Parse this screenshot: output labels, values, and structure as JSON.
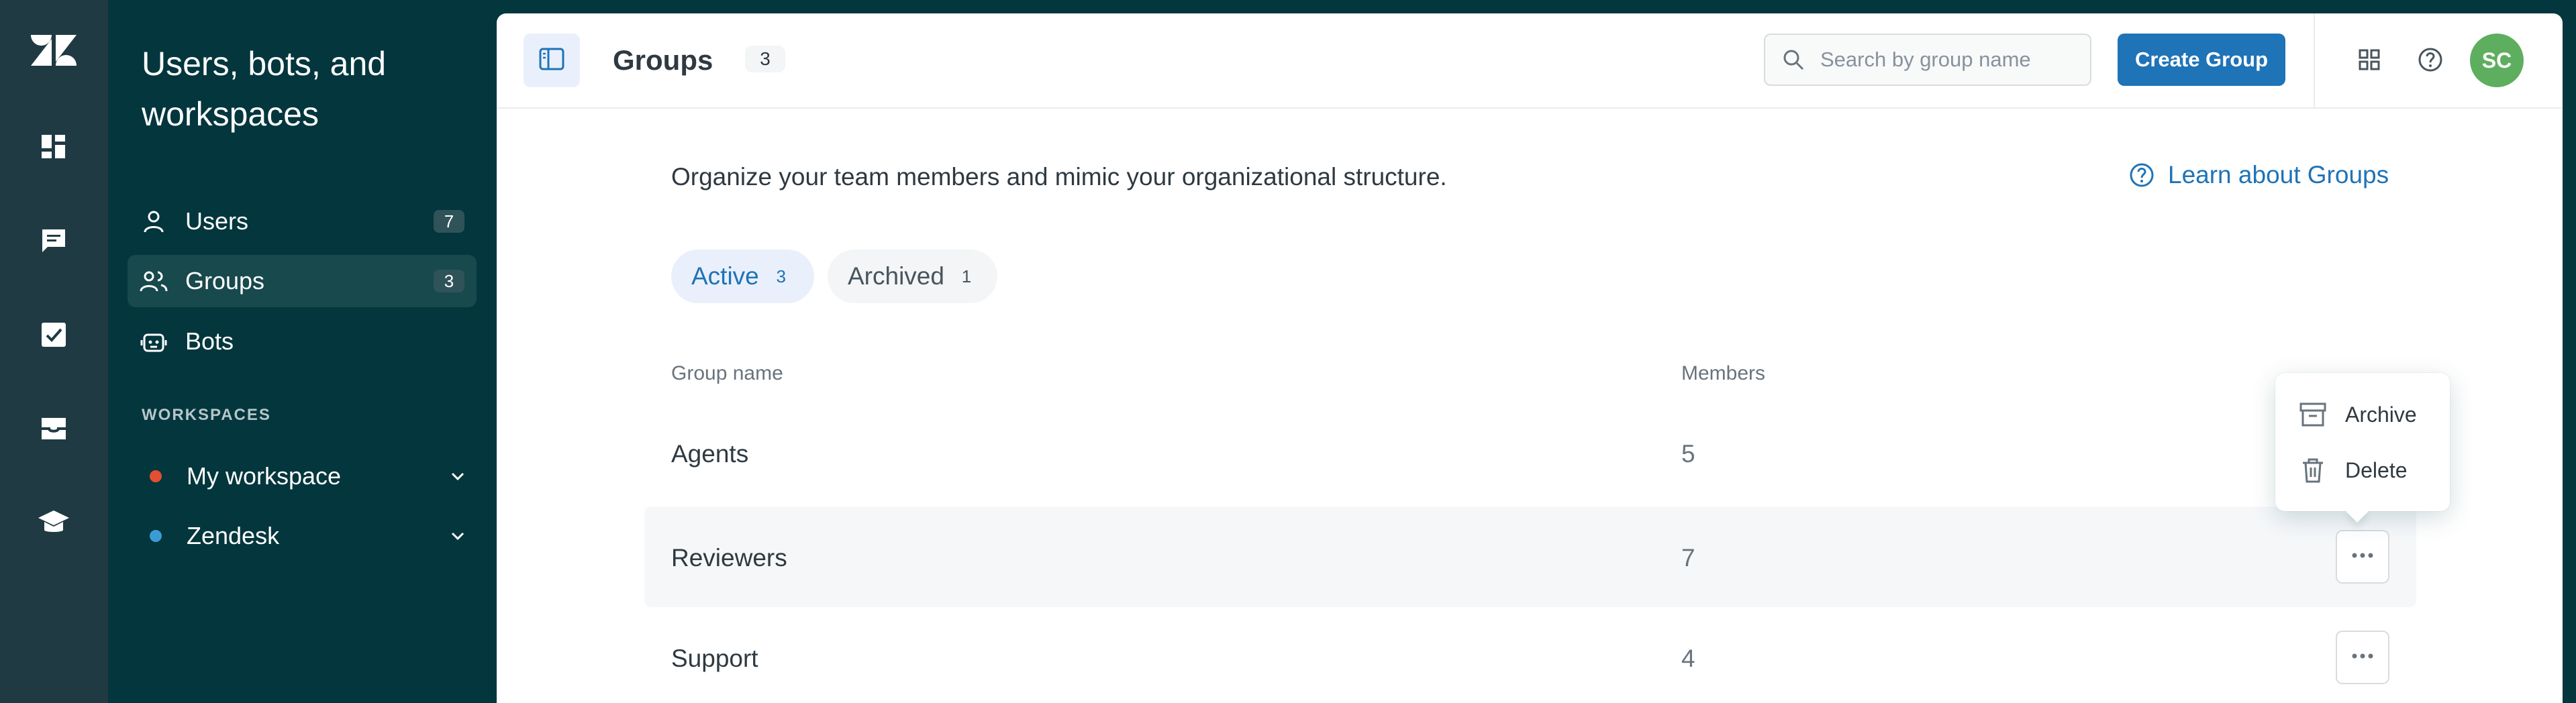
{
  "rail": {
    "logo": "zendesk-logo",
    "items": [
      "dashboard-icon",
      "conversations-icon",
      "tasks-icon",
      "inbox-icon",
      "learning-icon"
    ]
  },
  "sidebar": {
    "title": "Users, bots, and workspaces",
    "items": [
      {
        "label": "Users",
        "count": "7",
        "icon": "user-icon"
      },
      {
        "label": "Groups",
        "count": "3",
        "icon": "groups-icon",
        "active": true
      },
      {
        "label": "Bots",
        "icon": "bot-icon"
      }
    ],
    "workspaces_heading": "WORKSPACES",
    "workspaces": [
      {
        "label": "My workspace",
        "color": "#e34f32"
      },
      {
        "label": "Zendesk",
        "color": "#3c9bd5"
      }
    ]
  },
  "header": {
    "title": "Groups",
    "count": "3",
    "search_placeholder": "Search by group name",
    "create_label": "Create Group",
    "avatar_initials": "SC",
    "avatar_color": "#5eae5f"
  },
  "content": {
    "intro": "Organize your team members and mimic your organizational structure.",
    "learn_link": "Learn about Groups",
    "tabs": [
      {
        "label": "Active",
        "count": "3"
      },
      {
        "label": "Archived",
        "count": "1"
      }
    ],
    "columns": {
      "name": "Group name",
      "members": "Members"
    },
    "rows": [
      {
        "name": "Agents",
        "members": "5"
      },
      {
        "name": "Reviewers",
        "members": "7"
      },
      {
        "name": "Support",
        "members": "4"
      }
    ]
  },
  "menu": {
    "items": [
      {
        "label": "Archive",
        "icon": "archive-icon"
      },
      {
        "label": "Delete",
        "icon": "trash-icon"
      }
    ]
  },
  "colors": {
    "accent": "#1f73b7",
    "sidebar_bg": "#03363d"
  }
}
